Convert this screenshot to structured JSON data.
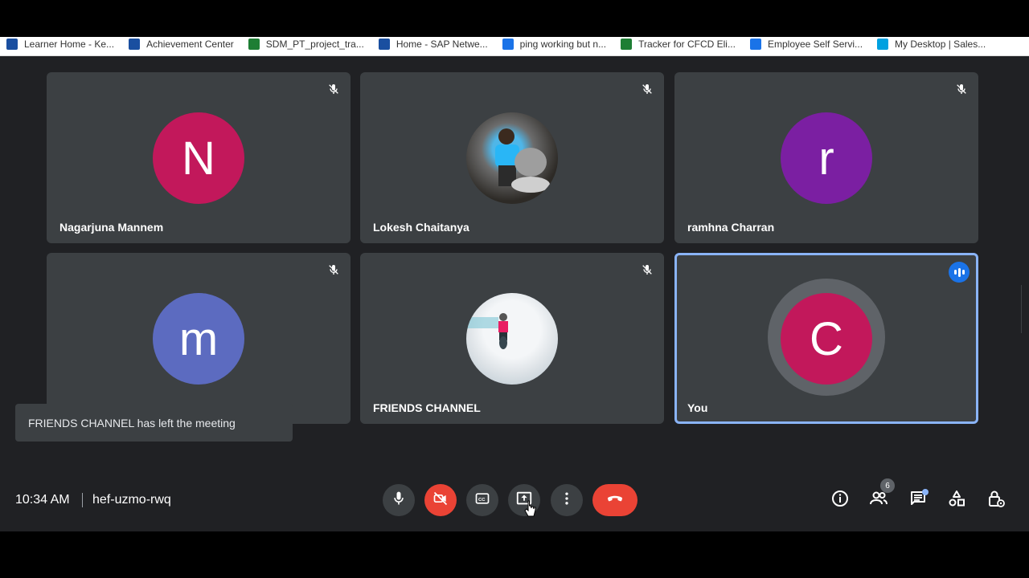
{
  "bookmarks": [
    {
      "label": "Learner Home - Ke...",
      "color": "#1a4fa0"
    },
    {
      "label": "Achievement Center",
      "color": "#1a4fa0"
    },
    {
      "label": "SDM_PT_project_tra...",
      "color": "#1e7e34"
    },
    {
      "label": "Home - SAP Netwe...",
      "color": "#1a4fa0"
    },
    {
      "label": "ping working but n...",
      "color": "#1a73e8"
    },
    {
      "label": "Tracker for CFCD Eli...",
      "color": "#1e7e34"
    },
    {
      "label": "Employee Self Servi...",
      "color": "#1a73e8"
    },
    {
      "label": "My Desktop | Sales...",
      "color": "#00a1e0"
    }
  ],
  "participants": [
    {
      "name": "Nagarjuna Mannem",
      "initial": "N",
      "color": "#c2185b"
    },
    {
      "name": "Lokesh Chaitanya",
      "initial": "",
      "color": "#555"
    },
    {
      "name": "ramhna Charran",
      "initial": "r",
      "color": "#7b1fa2"
    },
    {
      "name": "",
      "initial": "m",
      "color": "#5c6bc0"
    },
    {
      "name": "FRIENDS CHANNEL",
      "initial": "",
      "color": "#ddd"
    },
    {
      "name": "You",
      "initial": "C",
      "color": "#c2185b"
    }
  ],
  "toast": "FRIENDS CHANNEL has left the meeting",
  "meeting": {
    "time": "10:34 AM",
    "code": "hef-uzmo-rwq"
  },
  "people_count": "6",
  "icons": {
    "mic": "mic-icon",
    "camera": "camera-off-icon",
    "captions": "captions-icon",
    "present": "present-icon",
    "more": "more-vert-icon",
    "hangup": "hang-up-icon",
    "info": "info-icon",
    "people": "people-icon",
    "chat": "chat-icon",
    "activities": "activities-icon",
    "host": "host-controls-icon"
  },
  "colors": {
    "accent": "#8ab4f8",
    "danger": "#ea4335",
    "tile": "#3c4043",
    "background": "#202124"
  }
}
